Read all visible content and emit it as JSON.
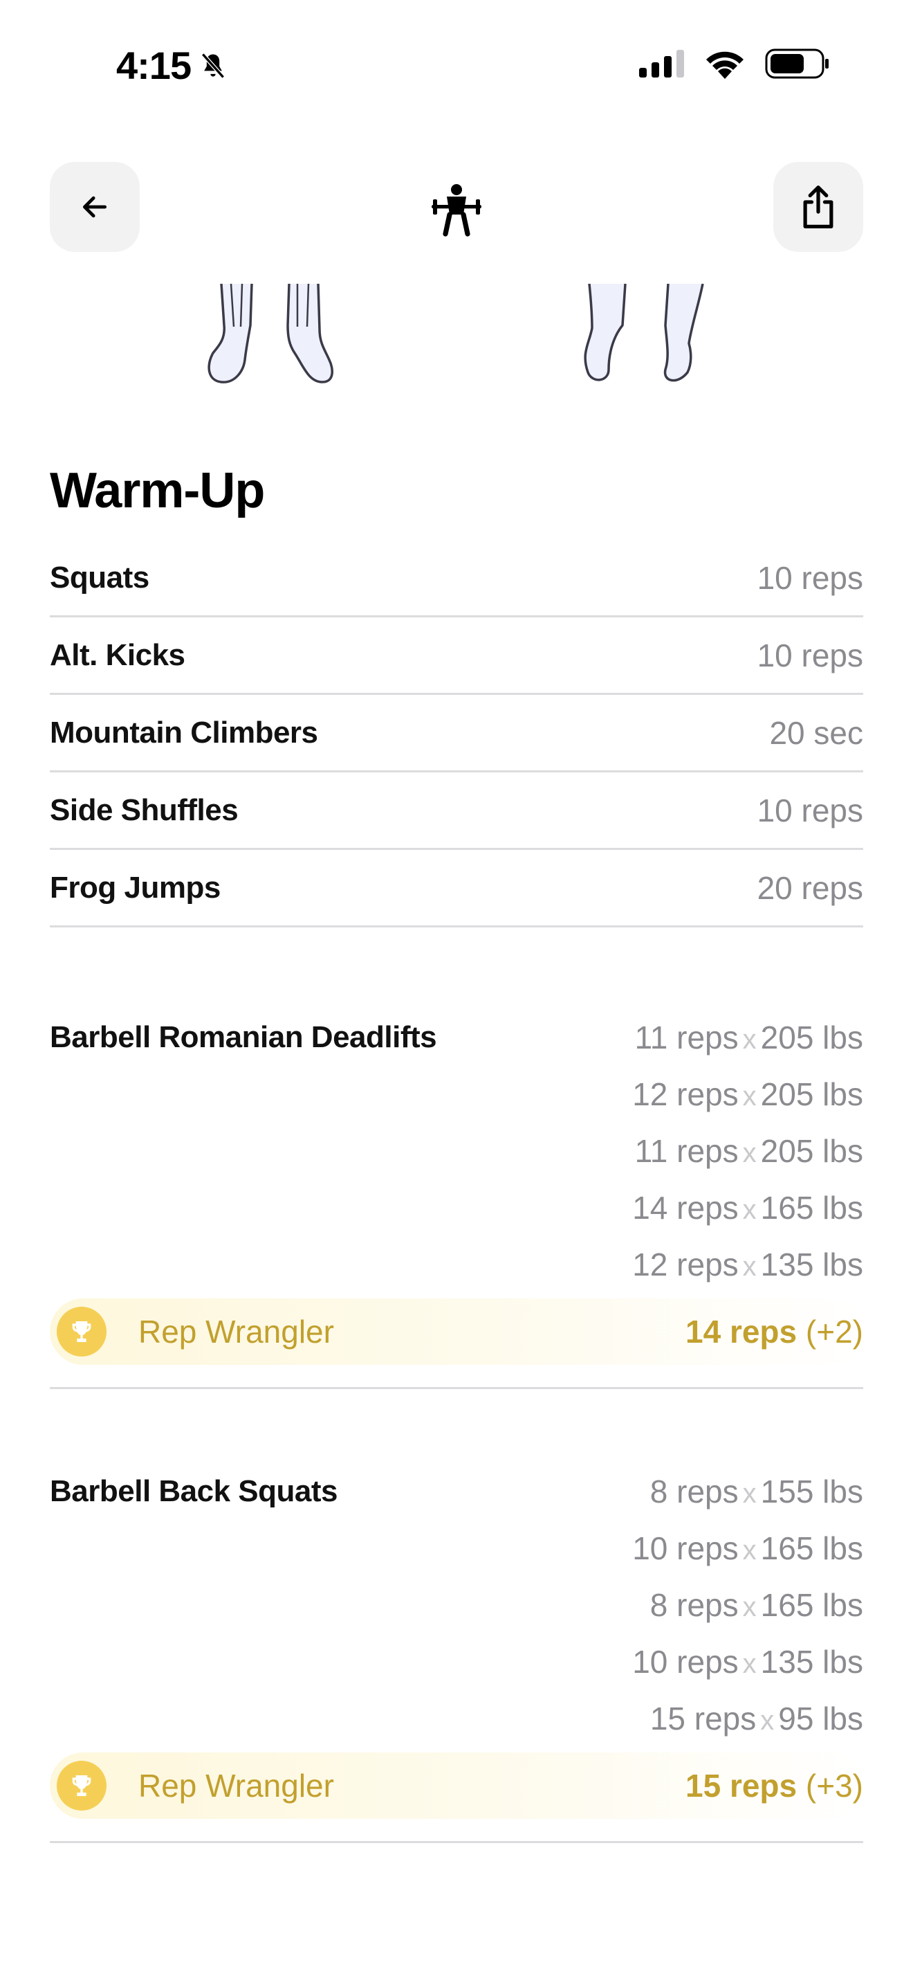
{
  "status_bar": {
    "time": "4:15",
    "icons": [
      "bell-slash-icon",
      "cellular-signal-icon",
      "wifi-icon",
      "battery-icon"
    ]
  },
  "nav": {
    "back_icon": "arrow-left-icon",
    "center_icon": "weightlifter-icon",
    "share_icon": "share-icon"
  },
  "warmup": {
    "title": "Warm-Up",
    "items": [
      {
        "name": "Squats",
        "value": "10 reps"
      },
      {
        "name": "Alt. Kicks",
        "value": "10 reps"
      },
      {
        "name": "Mountain Climbers",
        "value": "20 sec"
      },
      {
        "name": "Side Shuffles",
        "value": "10 reps"
      },
      {
        "name": "Frog Jumps",
        "value": "20 reps"
      }
    ]
  },
  "exercises": [
    {
      "name": "Barbell Romanian Deadlifts",
      "sets": [
        {
          "reps": "11 reps",
          "weight": "205 lbs"
        },
        {
          "reps": "12 reps",
          "weight": "205 lbs"
        },
        {
          "reps": "11 reps",
          "weight": "205 lbs"
        },
        {
          "reps": "14 reps",
          "weight": "165 lbs"
        },
        {
          "reps": "12 reps",
          "weight": "135 lbs"
        }
      ],
      "award": {
        "icon": "trophy-icon",
        "label": "Rep Wrangler",
        "value": "14 reps",
        "delta": "(+2)"
      }
    },
    {
      "name": "Barbell Back Squats",
      "sets": [
        {
          "reps": "8 reps",
          "weight": "155 lbs"
        },
        {
          "reps": "10 reps",
          "weight": "165 lbs"
        },
        {
          "reps": "8 reps",
          "weight": "165 lbs"
        },
        {
          "reps": "10 reps",
          "weight": "135 lbs"
        },
        {
          "reps": "15 reps",
          "weight": "95 lbs"
        }
      ],
      "award": {
        "icon": "trophy-icon",
        "label": "Rep Wrangler",
        "value": "15 reps",
        "delta": "(+3)"
      }
    }
  ],
  "set_separator": "x",
  "colors": {
    "award_gold": "#c2a02e",
    "trophy_bg": "#f5cf55",
    "muted_text": "#8a8a8f",
    "divider": "#dcdcdf"
  }
}
